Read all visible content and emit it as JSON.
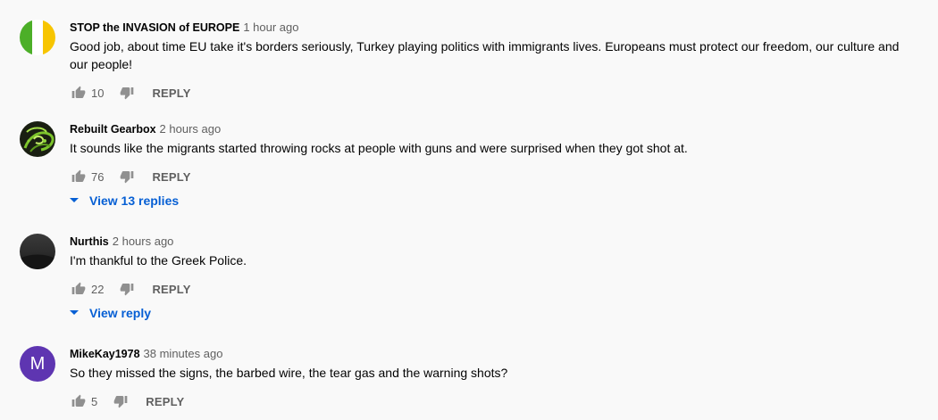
{
  "comments": [
    {
      "author": "STOP the INVASION of EUROPE",
      "time": "1 hour ago",
      "text": "Good job, about time EU take it's borders seriously, Turkey playing politics with immigrants lives.  Europeans must protect our freedom, our culture and our people!",
      "likes": "10",
      "reply_label": "REPLY",
      "avatar": "flag-green-white-yellow"
    },
    {
      "author": "Rebuilt Gearbox",
      "time": "2 hours ago",
      "text": "It sounds like the migrants started throwing rocks at people with guns and were surprised when they got shot at.",
      "likes": "76",
      "reply_label": "REPLY",
      "avatar": "green-swirl",
      "replies_label": "View 13 replies"
    },
    {
      "author": "Nurthis",
      "time": "2 hours ago",
      "text": "I'm thankful to the Greek Police.",
      "likes": "22",
      "reply_label": "REPLY",
      "avatar": "dark-gradient",
      "replies_label": "View reply"
    },
    {
      "author": "MikeKay1978",
      "time": "38 minutes ago",
      "text": "So they missed the signs, the barbed wire, the tear gas and the warning shots?",
      "likes": "5",
      "reply_label": "REPLY",
      "avatar": "letter-avatar",
      "avatar_letter": "M",
      "avatar_color": "#5e35b1"
    }
  ],
  "colors": {
    "link": "#065fd4",
    "secondary_text": "#606060",
    "background": "#f9f9f9"
  }
}
